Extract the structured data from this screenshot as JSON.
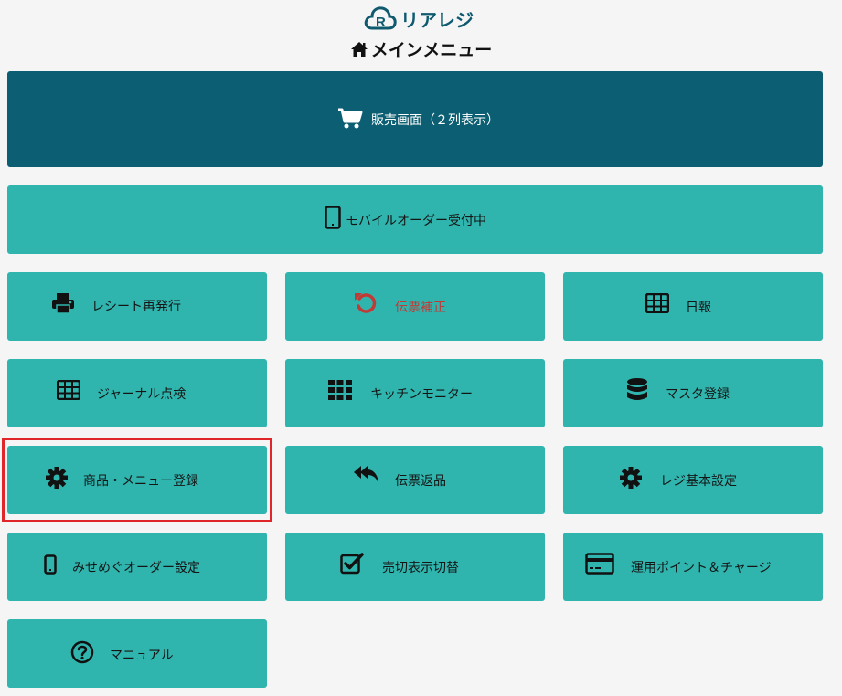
{
  "app": {
    "logo_text": "リアレジ",
    "page_title": "メインメニュー"
  },
  "colors": {
    "button_bg": "#2fb5ae",
    "primary_bg": "#0c5f72",
    "danger_text": "#c23a36",
    "highlight_border": "#e0262b"
  },
  "menu": {
    "sales": {
      "label": "販売画面（２列表示）",
      "icon": "cart-icon"
    },
    "mobile_order": {
      "label": "モバイルオーダー受付中",
      "icon": "tablet-icon"
    },
    "receipt_reprint": {
      "label": "レシート再発行",
      "icon": "printer-icon"
    },
    "slip_correction": {
      "label": "伝票補正",
      "icon": "undo-icon"
    },
    "daily_report": {
      "label": "日報",
      "icon": "table-icon"
    },
    "journal": {
      "label": "ジャーナル点検",
      "icon": "table-icon"
    },
    "kitchen_monitor": {
      "label": "キッチンモニター",
      "icon": "grid-icon"
    },
    "master_register": {
      "label": "マスタ登録",
      "icon": "database-icon"
    },
    "product_menu": {
      "label": "商品・メニュー登録",
      "icon": "gear-icon"
    },
    "slip_return": {
      "label": "伝票返品",
      "icon": "reply-all-icon"
    },
    "register_basic": {
      "label": "レジ基本設定",
      "icon": "gear-icon"
    },
    "misemegu": {
      "label": "みせめぐオーダー設定",
      "icon": "mobile-icon"
    },
    "soldout": {
      "label": "売切表示切替",
      "icon": "check-square-icon"
    },
    "points": {
      "label": "運用ポイント＆チャージ",
      "icon": "credit-card-icon"
    },
    "manual": {
      "label": "マニュアル",
      "icon": "question-icon"
    }
  }
}
